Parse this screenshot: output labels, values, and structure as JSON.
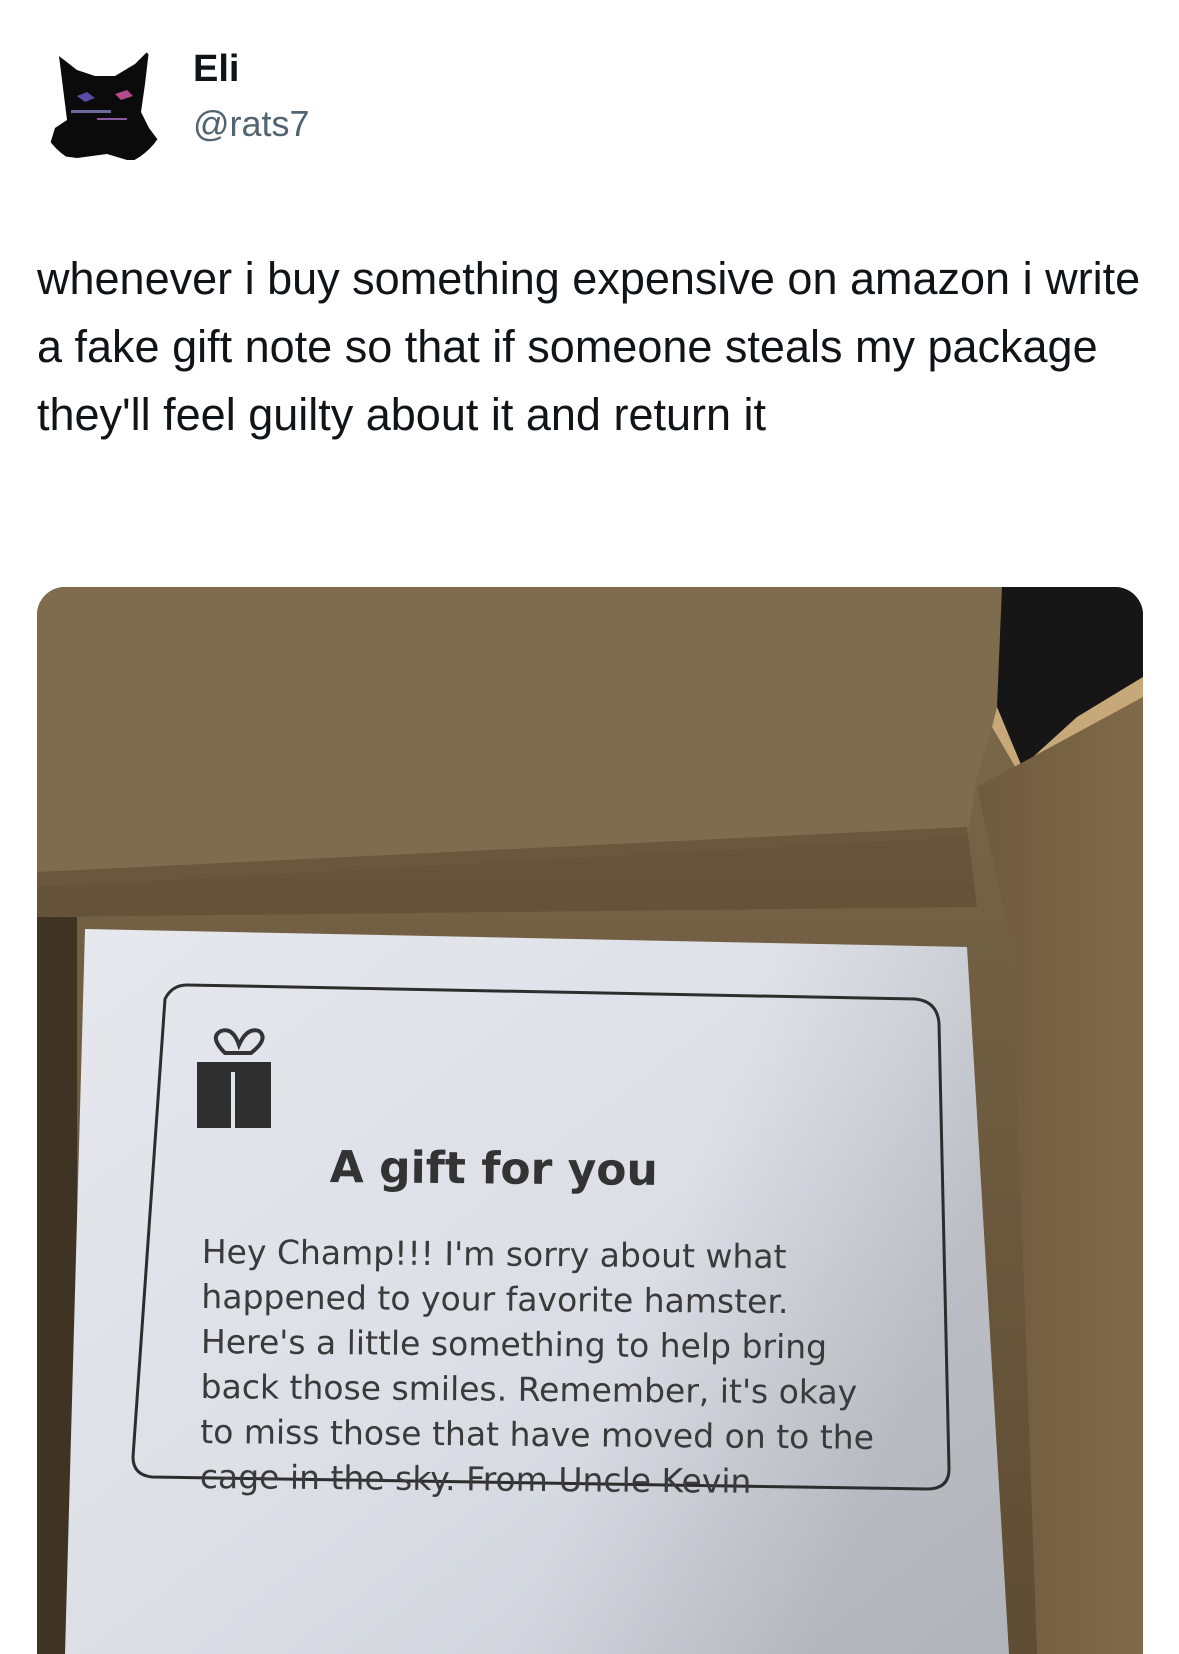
{
  "tweet": {
    "author": {
      "display_name": "Eli",
      "handle": "@rats7",
      "avatar_icon": "black-cat-avatar"
    },
    "text": "whenever i buy something expensive on amazon i write a fake gift note so that if someone steals my package they'll feel guilty about it and return it",
    "media": {
      "gift_note": {
        "icon": "gift-icon",
        "title": "A gift for you",
        "lines": [
          "Hey Champ!!! I'm sorry about what",
          "happened to your favorite hamster.",
          "Here's a little something to help bring",
          "back those smiles. Remember, it's okay",
          "to miss those that have moved on to the",
          "cage in the sky. From Uncle Kevin"
        ]
      }
    }
  }
}
